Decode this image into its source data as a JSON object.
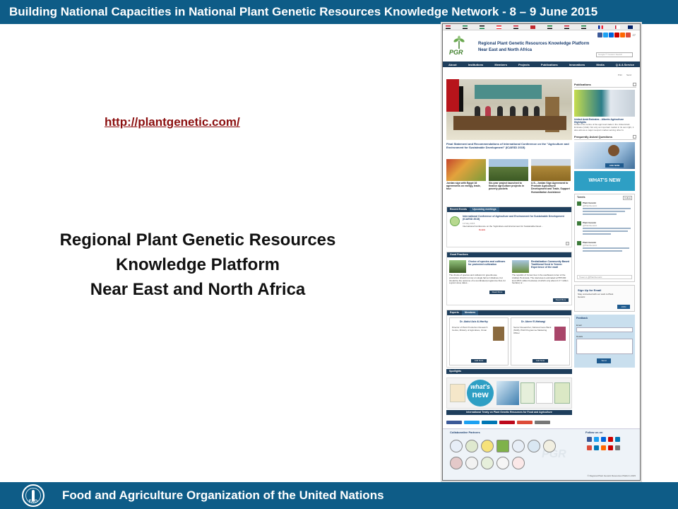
{
  "header": {
    "title": "Building National Capacities in National Plant Genetic Resources Knowledge Network - 8 – 9 June 2015"
  },
  "url": "http://plantgenetic.com/",
  "main_title": {
    "line1": "Regional Plant Genetic Resources",
    "line2": "Knowledge Platform",
    "line3": "Near East and North Africa"
  },
  "footer": {
    "org": "Food and Agriculture Organization of the United Nations",
    "logo_text": "FAO"
  },
  "site": {
    "title": "Regional Plant Genetic Resources Knowledge Platform",
    "subtitle": "Near East and North Africa",
    "logo": "PGR",
    "search_placeholder": "Google™ Custom Search",
    "social_count": "27",
    "nav": [
      "About",
      "Institutions",
      "Members",
      "Projects",
      "Publications",
      "Innovations",
      "Media",
      "Q & A Service"
    ],
    "util": [
      "Print",
      "Send"
    ],
    "hero_caption": "Final Statement and Recommendations of International Conference on the \"Agriculture and Environment for Sustainable Development\" (ICAESD 2015)",
    "thumbs": [
      {
        "caption": "Jordan sign with Egypt 16 agreements on energy, trade, tour",
        "color": "#c4442b"
      },
      {
        "caption": "Six-year project launched to finance agriculture projects in poverty pockets",
        "color": "#5d7a3b"
      },
      {
        "caption": "U.S., Jordan Sign Agreement to Promote Agricultural Development and Trade, Support Humanitarian Assistance",
        "color": "#b08a3a"
      }
    ],
    "recent_events": {
      "tab1": "Recent Events",
      "tab2": "Upcoming meetings",
      "item_title": "International Conference of Agriculture and Environment for Sustainable Development (ICAESD 2015)",
      "item_date": "13 May 2015",
      "item_text": "International Conference on the \"Agriculture and Environment for Sustainable Devel...",
      "details": "Details"
    },
    "good_practices": {
      "tab": "Good Practices",
      "p1_title": "Choice of species and cultivars for protected cultivation",
      "p1_text": "The choice of species and cultivars for greenhouse production should not rely on single farmer initiatives, but should be the outcome of a coordinated programme that, for a given area, takes...",
      "p2_title": "Revitalization Community Based Traditional Seed in Yemen: Experience of the wadi",
      "p2_text": "The republic of Yemen lies in the southwest corner of the Arabian Peninsula. The total area is estimated at 555 000 km2 (55.5 million hectares) of which only about 2.3 7 million hectare) or...",
      "read_more": "Read More"
    },
    "experts": {
      "tab1": "Experts",
      "tab2": "Members",
      "e1_name": "Dr. Abdul Aziz Al-Harthy",
      "e2_name": "Dr. Abeer El-Hatwagi",
      "e1_title": "Director of Plant Production Research Centre, Ministry of Agriculture, Oman",
      "e2_title": "Senior Researcher, National Gene Bank (NGB), PGR Programme Marketing Officer",
      "add_note": "Add Note"
    },
    "spotlights": {
      "tab": "Spotlights",
      "whats": "what's",
      "new": "new"
    },
    "treaty": "International Treaty on Plant Genetic Resources for Food and Agriculture",
    "share": [
      "Share",
      "Tweet",
      "Share",
      "Pinterest",
      "Google +",
      "Email"
    ],
    "right": {
      "publications": "Publications",
      "pub_title": "United Arab Emirates - Alberts Agriculture Highlights",
      "pub_text": "Dubai is the centre of the agri-food trade in the United Arab Emirates (UAE). Not only an important market in its own right, it also acts as a major reexport market serving other G",
      "faq": "Frequently Asked Questions",
      "ask_now": "ASK NOW",
      "whats_new": "WHAT'S NEW",
      "tweets": "Tweets",
      "follow": "Follow",
      "tweet_author": "Plant Genetic",
      "tweet_handle": "@PlantGenetic",
      "tweet_link": "Tweet to @PlantGenetic",
      "signup_title": "Sign Up for Email",
      "signup_desc": "Stay connected with our work to Plant Genetic",
      "join": "JOIN",
      "feedback": "Feedback",
      "email_label": "Email",
      "details_label": "Details",
      "send": "Send"
    },
    "partners": "Collaborative Partners",
    "follow_us": "Follow us on",
    "copyright": "© Regional Plant Genetic Resources Platform 2015"
  },
  "colors": {
    "brand_blue": "#0e5c87",
    "link_red": "#8b0f0f",
    "site_nav": "#1e3e5c"
  }
}
